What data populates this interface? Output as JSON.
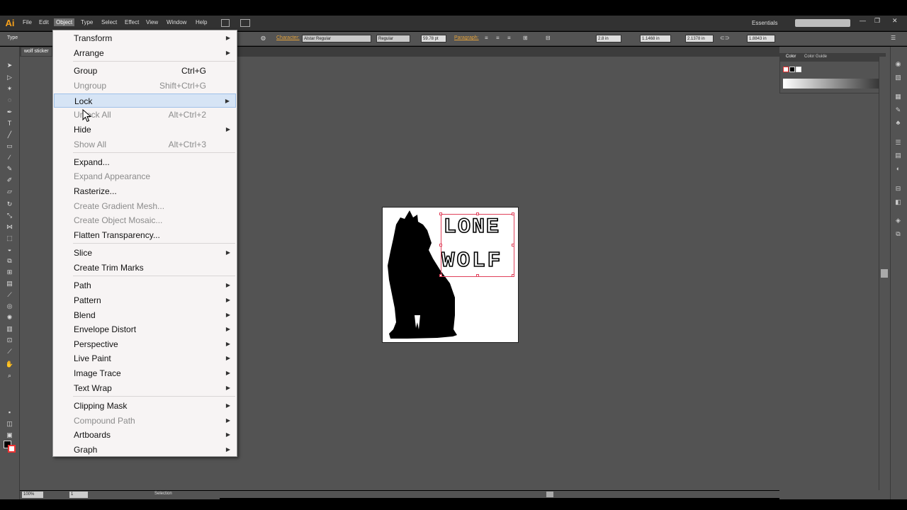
{
  "app": {
    "logo": "Ai"
  },
  "menubar": {
    "items": [
      "File",
      "Edit",
      "Object",
      "Type",
      "Select",
      "Effect",
      "View",
      "Window",
      "Help"
    ],
    "workspace": "Essentials",
    "window_controls": [
      "—",
      "❐",
      "✕"
    ]
  },
  "controlbar": {
    "type_label": "Type",
    "character_link": "Character:",
    "font_family": "Alstar Regular",
    "font_style": "Regular",
    "font_size": "59.78 pt",
    "paragraph_link": "Paragraph:",
    "x_value": "2.8 in",
    "y_value": "1.1468 in",
    "w_value": "2.1378 in",
    "h_value": "1.8843 in"
  },
  "document": {
    "tab_title": "wolf sticker"
  },
  "artwork": {
    "text_lines": [
      "LONE",
      "WOLF"
    ]
  },
  "color_panel": {
    "tabs": [
      "Color",
      "Color Guide"
    ]
  },
  "statusbar": {
    "zoom": "100%",
    "artboard": "1",
    "tool_status": "Selection"
  },
  "object_menu": {
    "items": [
      {
        "label": "Transform",
        "submenu": true,
        "enabled": true,
        "highlighted": false
      },
      {
        "label": "Arrange",
        "submenu": true,
        "enabled": true,
        "highlighted": false
      },
      {
        "label": "Group",
        "shortcut": "Ctrl+G",
        "enabled": true,
        "highlighted": false
      },
      {
        "label": "Ungroup",
        "shortcut": "Shift+Ctrl+G",
        "enabled": false,
        "highlighted": false
      },
      {
        "label": "Lock",
        "submenu": true,
        "enabled": true,
        "highlighted": true
      },
      {
        "label": "Unlock All",
        "shortcut": "Alt+Ctrl+2",
        "enabled": false,
        "highlighted": false
      },
      {
        "label": "Hide",
        "submenu": true,
        "enabled": true,
        "highlighted": false
      },
      {
        "label": "Show All",
        "shortcut": "Alt+Ctrl+3",
        "enabled": false,
        "highlighted": false
      },
      {
        "label": "Expand...",
        "enabled": true,
        "highlighted": false
      },
      {
        "label": "Expand Appearance",
        "enabled": false,
        "highlighted": false
      },
      {
        "label": "Rasterize...",
        "enabled": true,
        "highlighted": false
      },
      {
        "label": "Create Gradient Mesh...",
        "enabled": false,
        "highlighted": false
      },
      {
        "label": "Create Object Mosaic...",
        "enabled": false,
        "highlighted": false
      },
      {
        "label": "Flatten Transparency...",
        "enabled": true,
        "highlighted": false
      },
      {
        "label": "Slice",
        "submenu": true,
        "enabled": true,
        "highlighted": false
      },
      {
        "label": "Create Trim Marks",
        "enabled": true,
        "highlighted": false
      },
      {
        "label": "Path",
        "submenu": true,
        "enabled": true,
        "highlighted": false
      },
      {
        "label": "Pattern",
        "submenu": true,
        "enabled": true,
        "highlighted": false
      },
      {
        "label": "Blend",
        "submenu": true,
        "enabled": true,
        "highlighted": false
      },
      {
        "label": "Envelope Distort",
        "submenu": true,
        "enabled": true,
        "highlighted": false
      },
      {
        "label": "Perspective",
        "submenu": true,
        "enabled": true,
        "highlighted": false
      },
      {
        "label": "Live Paint",
        "submenu": true,
        "enabled": true,
        "highlighted": false
      },
      {
        "label": "Image Trace",
        "submenu": true,
        "enabled": true,
        "highlighted": false
      },
      {
        "label": "Text Wrap",
        "submenu": true,
        "enabled": true,
        "highlighted": false
      },
      {
        "label": "Clipping Mask",
        "submenu": true,
        "enabled": true,
        "highlighted": false
      },
      {
        "label": "Compound Path",
        "submenu": true,
        "enabled": false,
        "highlighted": false
      },
      {
        "label": "Artboards",
        "submenu": true,
        "enabled": true,
        "highlighted": false
      },
      {
        "label": "Graph",
        "submenu": true,
        "enabled": true,
        "highlighted": false
      }
    ]
  }
}
